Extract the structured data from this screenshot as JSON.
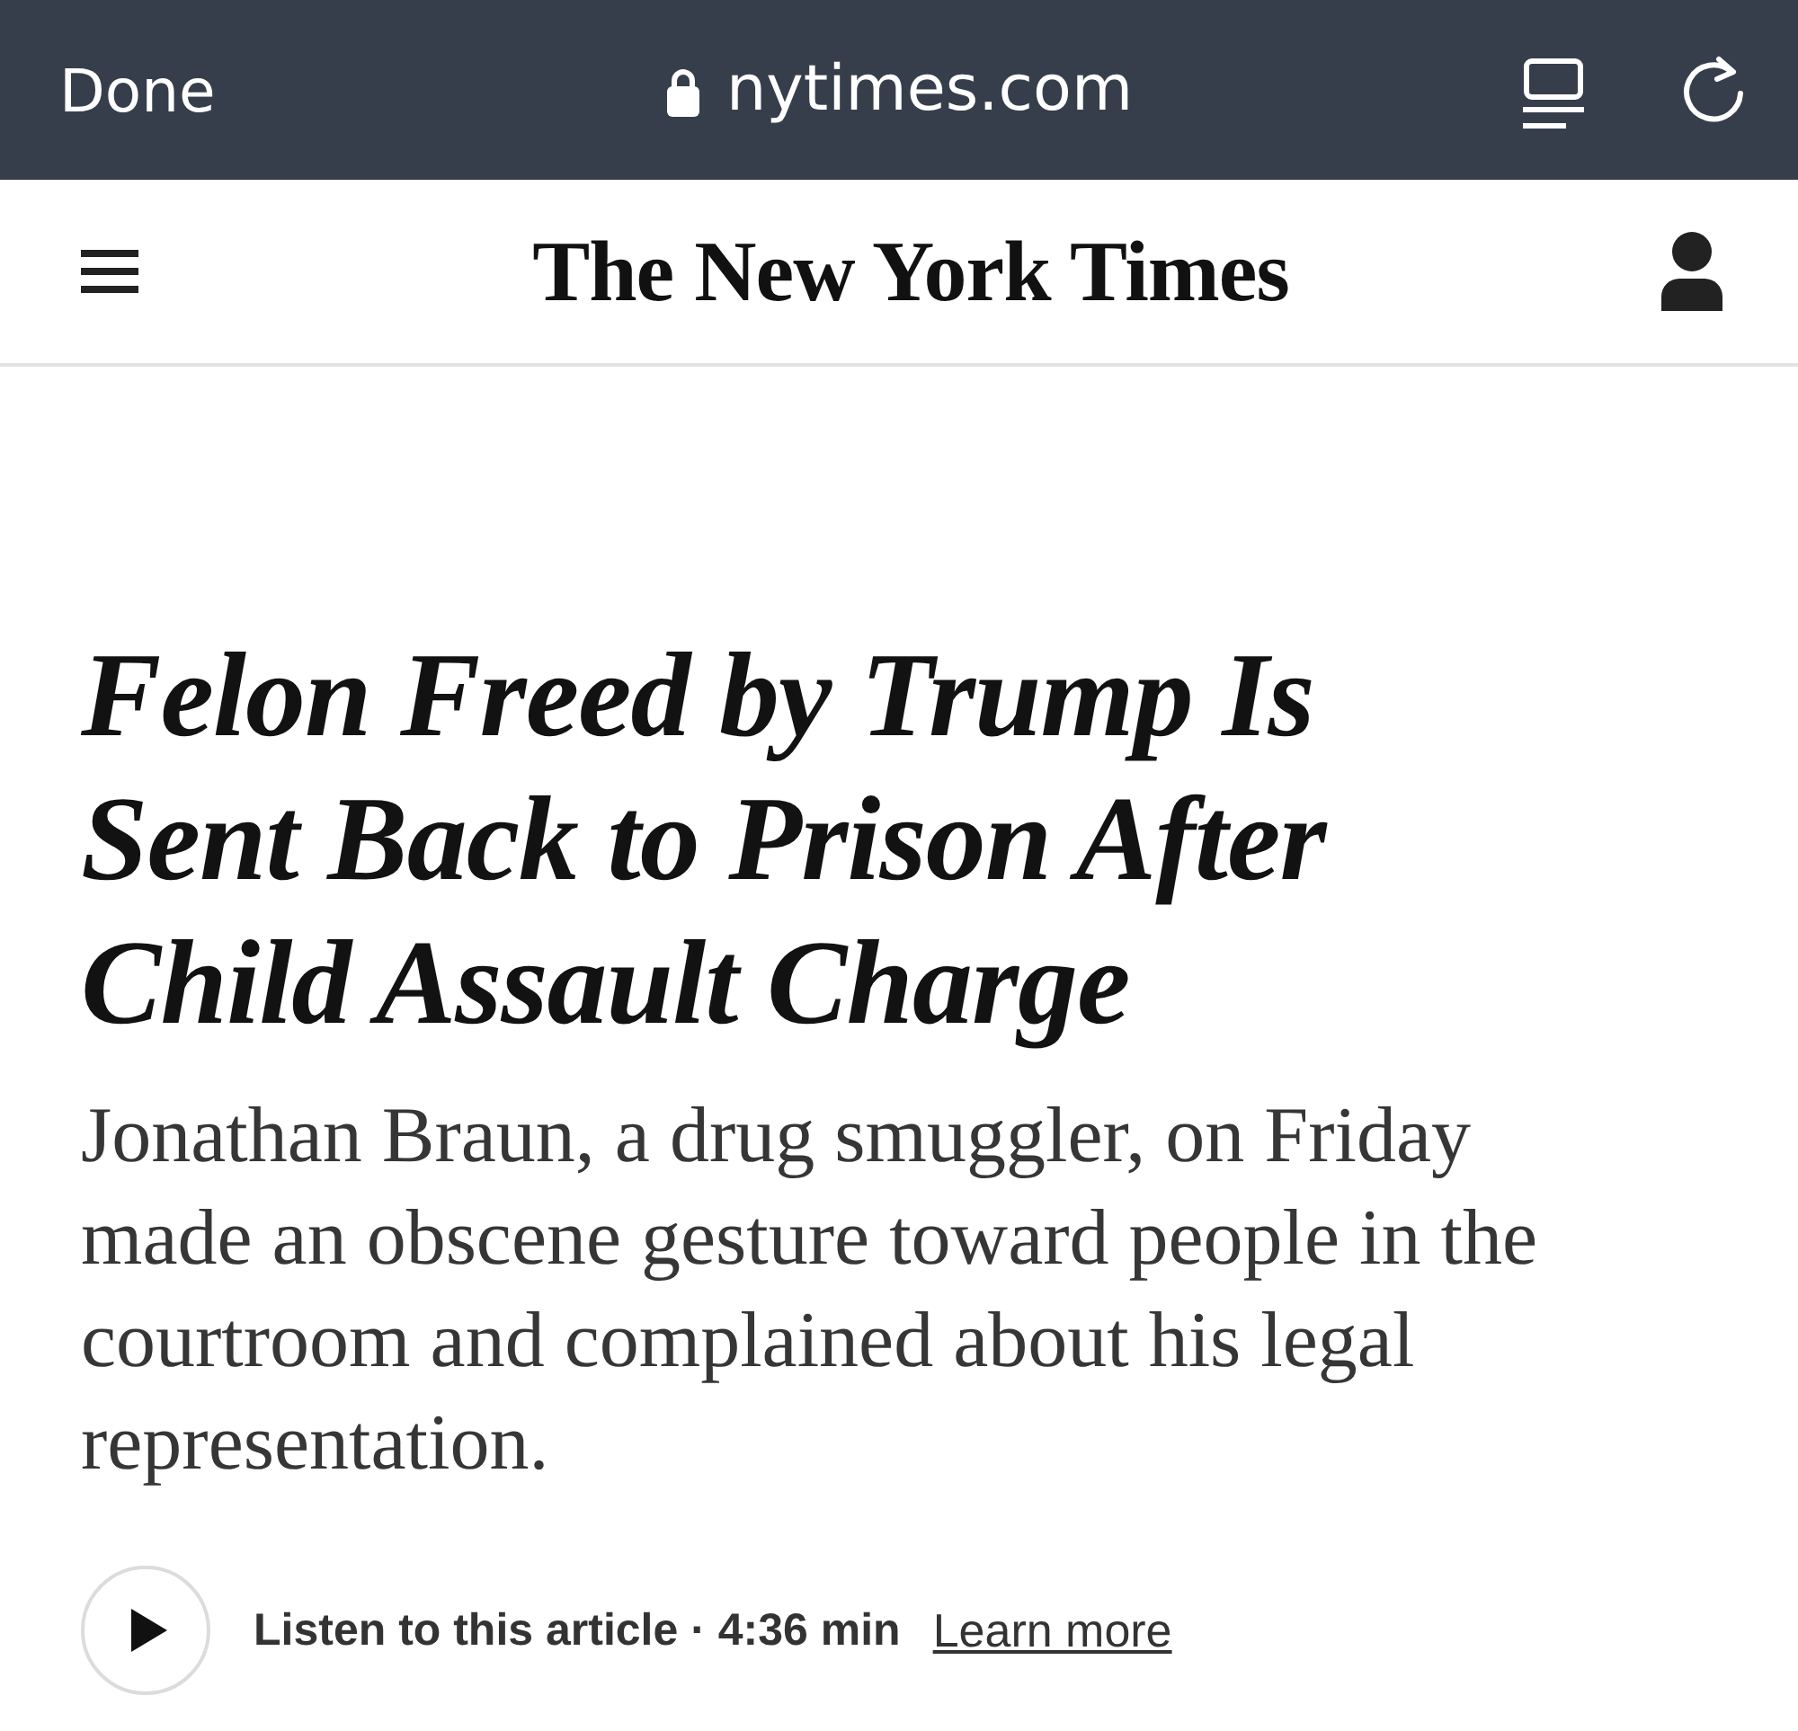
{
  "browser_bar": {
    "done_label": "Done",
    "url": "nytimes.com",
    "secure": true
  },
  "masthead": {
    "logo": "The New York Times"
  },
  "article": {
    "headline": "Felon Freed by Trump Is Sent Back to Prison After Child Assault Charge",
    "summary": "Jonathan Braun, a drug smuggler, on Friday made an obscene gesture toward people in the courtroom and complained about his legal representation.",
    "audio": {
      "label": "Listen to this article · 4:36 min",
      "link": "Learn more"
    }
  }
}
